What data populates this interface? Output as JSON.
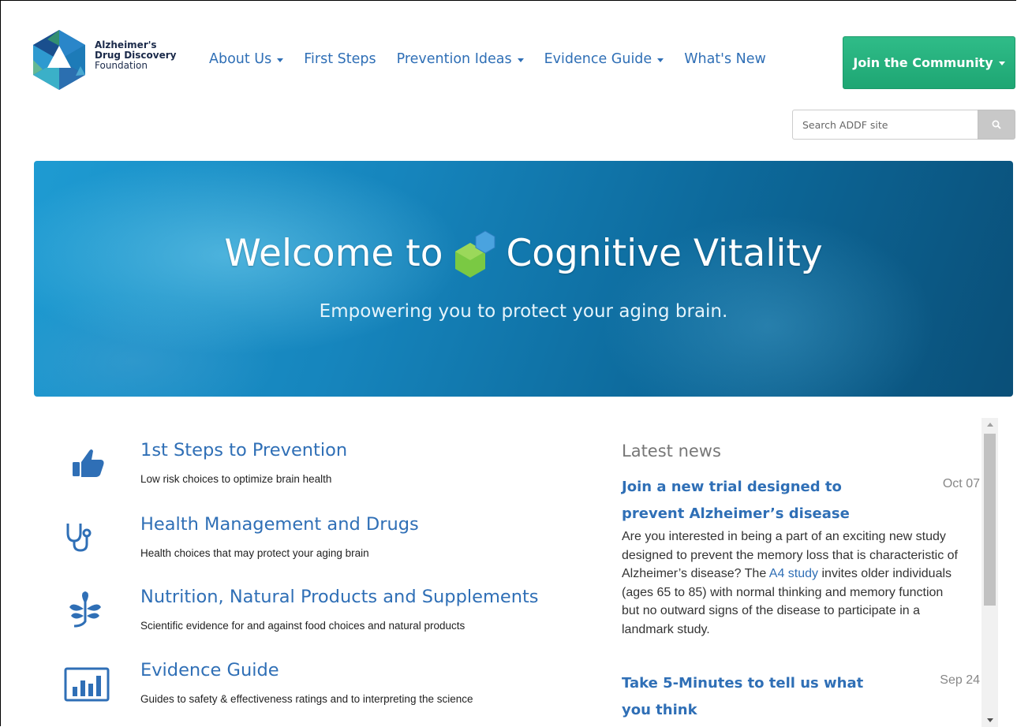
{
  "brand": {
    "line1": "Alzheimer's",
    "line2": "Drug Discovery",
    "line3": "Foundation"
  },
  "nav": {
    "about": "About Us",
    "first_steps": "First Steps",
    "prevention": "Prevention Ideas",
    "evidence": "Evidence Guide",
    "whats_new": "What's New"
  },
  "join": {
    "label": "Join the Community"
  },
  "search": {
    "placeholder": "Search ADDF site"
  },
  "hero": {
    "title_before": "Welcome to",
    "title_after": "Cognitive Vitality",
    "subtitle": "Empowering you to protect your aging brain."
  },
  "features": [
    {
      "title": "1st Steps to Prevention",
      "desc": "Low risk choices to optimize brain health",
      "icon": "thumbs-up-icon"
    },
    {
      "title": "Health Management and Drugs",
      "desc": "Health choices that may protect your aging brain",
      "icon": "stethoscope-icon"
    },
    {
      "title": "Nutrition, Natural Products and Supplements",
      "desc": "Scientific evidence for and against food choices and natural products",
      "icon": "plant-icon"
    },
    {
      "title": "Evidence Guide",
      "desc": "Guides to safety & effectiveness ratings and to interpreting the science",
      "icon": "bar-chart-icon"
    }
  ],
  "news": {
    "heading": "Latest news",
    "items": [
      {
        "title": "Join a new trial designed to prevent Alzheimer’s disease",
        "date": "Oct 07",
        "body_before": "Are you interested in being a part of an exciting new study designed to prevent the memory loss that is characteristic of Alzheimer’s disease? The",
        "link": "A4 study",
        "body_after": "invites older individuals (ages 65 to 85) with normal thinking and memory function but no outward signs of the disease to participate in a landmark study."
      },
      {
        "title": "Take 5-Minutes to tell us what you think",
        "date": "Sep 24"
      }
    ]
  },
  "colors": {
    "link": "#2f6fb6",
    "join_button": "#23b07c",
    "hero_start": "#1e9bd2",
    "hero_end": "#0a4f78"
  }
}
